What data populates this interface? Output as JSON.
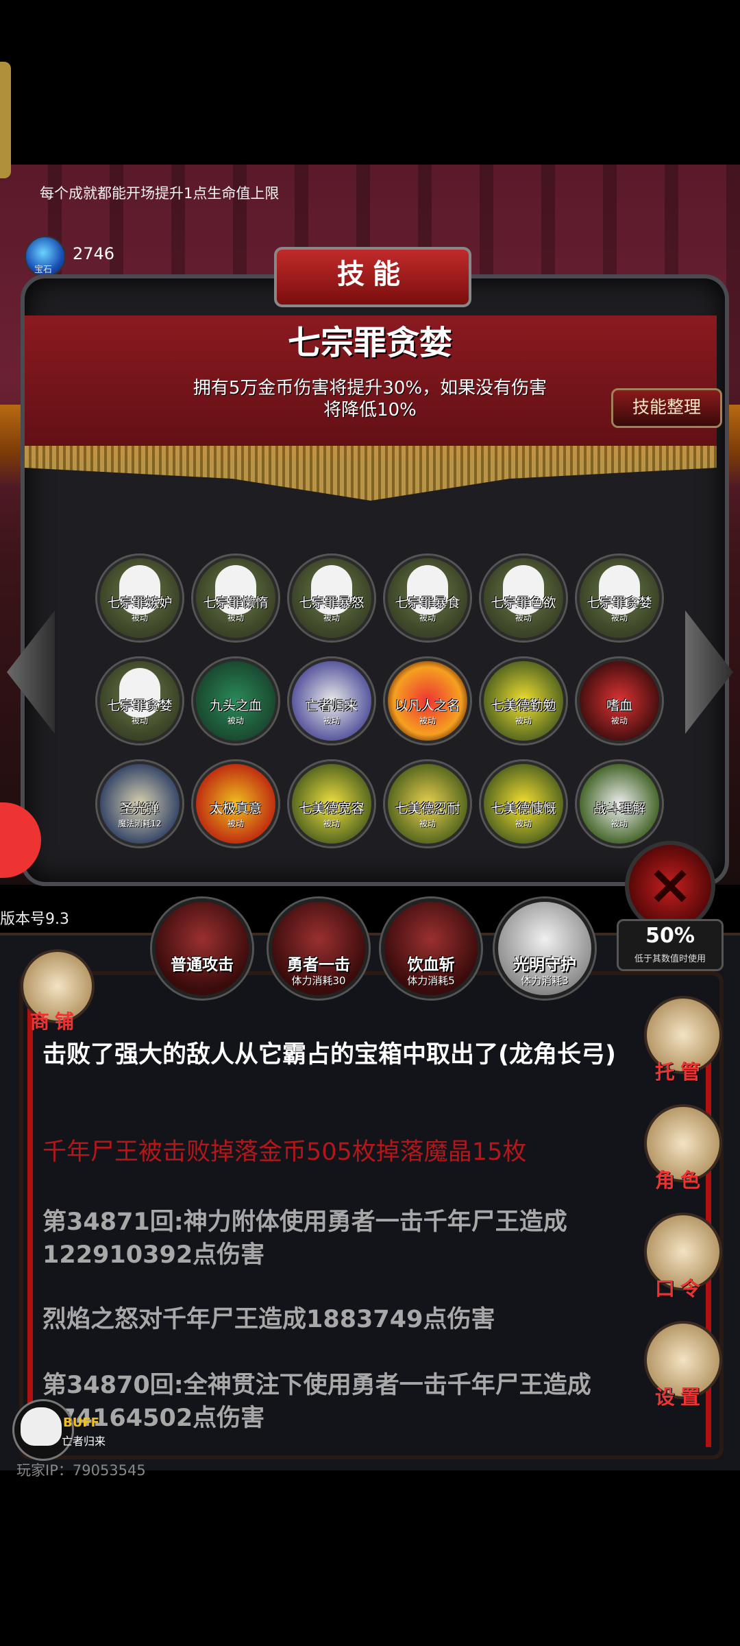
{
  "top_tip": "每个成就都能开场提升1点生命值上限",
  "gem": {
    "label": "宝石",
    "count": "2746"
  },
  "panel": {
    "title": "技能",
    "selected_skill_name": "七宗罪贪婪",
    "selected_skill_desc_line1": "拥有5万金币伤害将提升30%，如果没有伤害",
    "selected_skill_desc_line2": "将降低10%",
    "organize_button": "技能整理",
    "close_icon": "close-x-icon"
  },
  "skills": [
    {
      "name": "七宗罪嫉妒",
      "sub": "被动"
    },
    {
      "name": "七宗罪懒惰",
      "sub": "被动"
    },
    {
      "name": "七宗罪暴怒",
      "sub": "被动"
    },
    {
      "name": "七宗罪暴食",
      "sub": "被动"
    },
    {
      "name": "七宗罪色欲",
      "sub": "被动"
    },
    {
      "name": "七宗罪贪婪",
      "sub": "被动"
    },
    {
      "name": "七宗罪贪婪",
      "sub": "被动"
    },
    {
      "name": "九头之血",
      "sub": "被动"
    },
    {
      "name": "亡者归来",
      "sub": "被动"
    },
    {
      "name": "以凡人之名",
      "sub": "被动"
    },
    {
      "name": "七美德勤勉",
      "sub": "被动"
    },
    {
      "name": "嗜血",
      "sub": "被动"
    },
    {
      "name": "圣光弹",
      "sub": "魔法消耗12"
    },
    {
      "name": "太极真意",
      "sub": "被动"
    },
    {
      "name": "七美德宽容",
      "sub": "被动"
    },
    {
      "name": "七美德忍耐",
      "sub": "被动"
    },
    {
      "name": "七美德慷慨",
      "sub": "被动"
    },
    {
      "name": "战斗理解",
      "sub": "被动"
    }
  ],
  "version": "版本号9.3",
  "attacks": [
    {
      "label": "普通攻击",
      "cost": ""
    },
    {
      "label": "勇者一击",
      "cost": "体力消耗30"
    },
    {
      "label": "饮血斩",
      "cost": "体力消耗5"
    },
    {
      "label": "光明守护",
      "cost": "体力消耗3"
    }
  ],
  "auto": {
    "value": "50%",
    "sub": "低于其数值时使用"
  },
  "shop_label": "商铺",
  "side_buttons": [
    {
      "label": "托管",
      "icon": "dice-icon"
    },
    {
      "label": "角色",
      "icon": "hooded-figure-icon"
    },
    {
      "label": "口令",
      "icon": "book-icon"
    },
    {
      "label": "设置",
      "icon": "gear-icon"
    }
  ],
  "battle_log": [
    "击败了强大的敌人从它霸占的宝箱中取出了(龙角长弓)",
    "千年尸王被击败掉落金币505枚掉落魔晶15枚",
    "第34871回:神力附体使用勇者一击千年尸王造成122910392点伤害",
    "烈焰之怒对千年尸王造成1883749点伤害",
    "第34870回:全神贯注下使用勇者一击千年尸王造成174164502点伤害"
  ],
  "buff": {
    "tag": "BUFF",
    "name": "亡者归来"
  },
  "player_ip": "玩家IP：79053545"
}
